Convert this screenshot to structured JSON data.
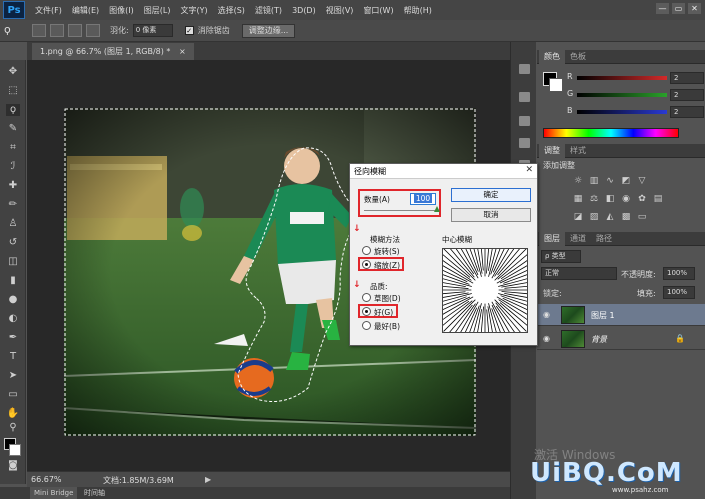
{
  "app": {
    "logo": "Ps",
    "menu": [
      "文件(F)",
      "编辑(E)",
      "图像(I)",
      "图层(L)",
      "文字(Y)",
      "选择(S)",
      "滤镜(T)",
      "3D(D)",
      "视图(V)",
      "窗口(W)",
      "帮助(H)"
    ],
    "window_controls": [
      "—",
      "▭",
      "✕"
    ]
  },
  "options_bar": {
    "feather_label": "羽化:",
    "feather_value": "0 像素",
    "antialias_label": "消除锯齿",
    "antialias_checked": true,
    "refine_edge_button": "调整边缘..."
  },
  "document": {
    "tab_title": "1.png @ 66.7% (图层 1, RGB/8) *",
    "tab_close": "×"
  },
  "status_bar": {
    "zoom": "66.67%",
    "doc_size": "文档:1.85M/3.69M",
    "arrow": "▶"
  },
  "bottom_tabs": [
    "Mini Bridge",
    "时间轴"
  ],
  "color_panel": {
    "tabs": [
      "颜色",
      "色板"
    ],
    "sliders": [
      {
        "label": "R",
        "value": "2",
        "color": "#d42a2a"
      },
      {
        "label": "G",
        "value": "2",
        "color": "#2aa12a"
      },
      {
        "label": "B",
        "value": "2",
        "color": "#2a3ad4"
      }
    ]
  },
  "adjustments_panel": {
    "tabs": [
      "调整",
      "样式"
    ],
    "title": "添加调整"
  },
  "layers_panel": {
    "tabs": [
      "图层",
      "通道",
      "路径"
    ],
    "kind_filter": "ρ 类型",
    "blend_mode": "正常",
    "opacity_label": "不透明度:",
    "opacity_value": "100%",
    "lock_label": "锁定:",
    "fill_label": "填充:",
    "fill_value": "100%",
    "layers": [
      {
        "name": "图层 1",
        "selected": true
      },
      {
        "name": "背景",
        "selected": false
      }
    ]
  },
  "watermark": {
    "line1": "激活 Windows",
    "line2": "UiBQ.CoM",
    "line3": "www.psahz.com"
  },
  "dialog": {
    "title": "径向模糊",
    "close": "✕",
    "amount_label": "数量(A)",
    "amount_value": "100",
    "ok_button": "确定",
    "cancel_button": "取消",
    "blur_method_label": "模糊方法",
    "blur_methods": [
      {
        "label": "旋转(S)",
        "checked": false
      },
      {
        "label": "缩放(Z)",
        "checked": true
      }
    ],
    "quality_label": "品质:",
    "qualities": [
      {
        "label": "草图(D)",
        "checked": false
      },
      {
        "label": "好(G)",
        "checked": true
      },
      {
        "label": "最好(B)",
        "checked": false
      }
    ],
    "center_label": "中心模糊"
  },
  "colors": {
    "selection_red": "#e0262b",
    "accent_blue": "#2c6fd1"
  }
}
